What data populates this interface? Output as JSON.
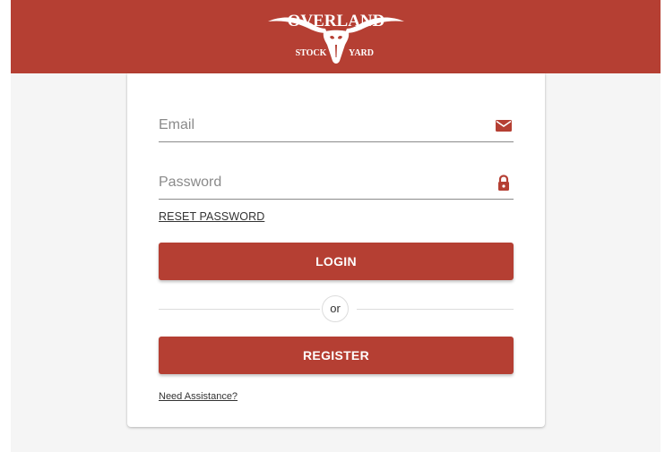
{
  "header": {
    "logo": {
      "top_text": "OVERLAND",
      "left_text": "STOCK",
      "right_text": "YARD",
      "icon": "longhorn-steer-skull-icon"
    },
    "background_color": "#b53f33"
  },
  "form": {
    "email": {
      "placeholder": "Email",
      "value": "",
      "icon": "envelope-icon"
    },
    "password": {
      "placeholder": "Password",
      "value": "",
      "icon": "lock-icon"
    },
    "reset_password_label": "RESET PASSWORD",
    "login_label": "LOGIN",
    "divider_label": "or",
    "register_label": "REGISTER",
    "assistance_label": "Need Assistance?"
  },
  "colors": {
    "accent": "#b53f33",
    "placeholder": "#8a8a8a",
    "page_background": "#f5f5f5"
  }
}
